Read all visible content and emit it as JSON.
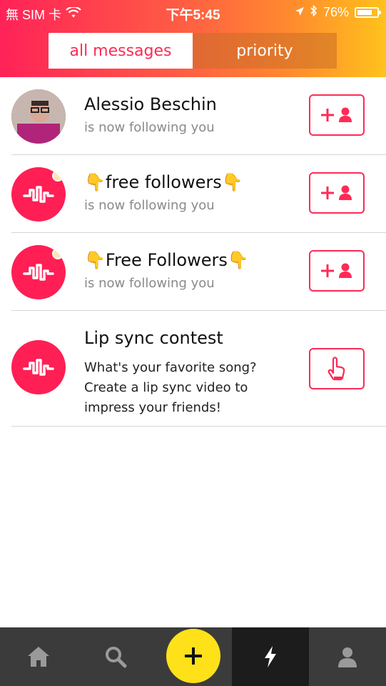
{
  "status_bar": {
    "carrier": "無 SIM 卡",
    "time": "下午5:45",
    "battery_percent": "76%",
    "battery_level": 0.76
  },
  "tabs": {
    "all_messages": "all messages",
    "priority": "priority",
    "active": "all messages"
  },
  "messages": [
    {
      "title": "Alessio Beschin",
      "subtitle": "is now following you",
      "avatar": "user-photo",
      "action": "follow-back"
    },
    {
      "title": "👇free followers👇",
      "subtitle": "is now following you",
      "avatar": "musically-logo",
      "action": "follow-back"
    },
    {
      "title": "👇Free Followers👇",
      "subtitle": "is now following you",
      "avatar": "musically-logo",
      "action": "follow-back"
    },
    {
      "title": "Lip sync contest",
      "description": "What's your favorite song? Create a lip sync video to impress your friends!",
      "avatar": "musically-logo",
      "action": "tap"
    }
  ],
  "bottom_nav": [
    "home-icon",
    "search-icon",
    "add-icon",
    "notifications-icon",
    "profile-icon"
  ],
  "colors": {
    "accent": "#ff2a55",
    "add_button": "#ffe11a",
    "tabbar": "#3b3b3b"
  }
}
